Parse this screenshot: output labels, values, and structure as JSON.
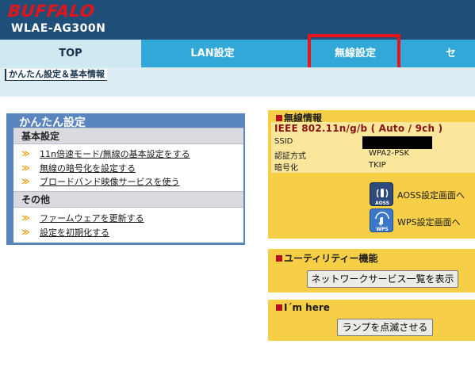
{
  "header": {
    "brand": "BUFFALO",
    "model": "WLAE-AG300N"
  },
  "tabs": [
    {
      "label": "TOP",
      "state": "active"
    },
    {
      "label": "LAN設定",
      "state": "normal"
    },
    {
      "label": "無線設定",
      "state": "highlighted"
    },
    {
      "label": "セ",
      "state": "normal"
    }
  ],
  "subtabs": {
    "current": "かんたん設定＆基本情報"
  },
  "easy_panel": {
    "title": "かんたん設定",
    "sections": [
      {
        "heading": "基本設定",
        "links": [
          "11n倍速モード/無線の基本設定をする",
          "無線の暗号化を設定する",
          "ブロードバンド映像サービスを使う"
        ]
      },
      {
        "heading": "その他",
        "links": [
          "ファームウェアを更新する",
          "設定を初期化する"
        ]
      }
    ],
    "arrow_glyph": "≫"
  },
  "wireless_info": {
    "title": "無線情報",
    "standard": "IEEE 802.11n/g/b ( Auto / 9ch )",
    "rows": [
      {
        "label": "SSID",
        "value": ""
      },
      {
        "label": "認証方式",
        "value": "WPA2-PSK"
      },
      {
        "label": "暗号化",
        "value": "TKIP"
      }
    ],
    "aoss_icon_text": "AOSS",
    "wps_icon_text": "WPS",
    "aoss_link": "AOSS設定画面へ",
    "wps_link": "WPS設定画面へ"
  },
  "utility": {
    "title": "ユーティリティー機能",
    "button": "ネットワークサービス一覧を表示"
  },
  "im_here": {
    "title": "I´m here",
    "button": "ランプを点滅させる"
  },
  "colors": {
    "header_bg": "#1f4f78",
    "brand_red": "#e3141a",
    "tab_active": "#cfe9f2",
    "tab_normal": "#32a8d9",
    "highlight_box": "#e8141a",
    "easy_panel_blue": "#5a84bd",
    "info_panel_yellow": "#f7cf46",
    "arrow_orange": "#f29a00"
  }
}
